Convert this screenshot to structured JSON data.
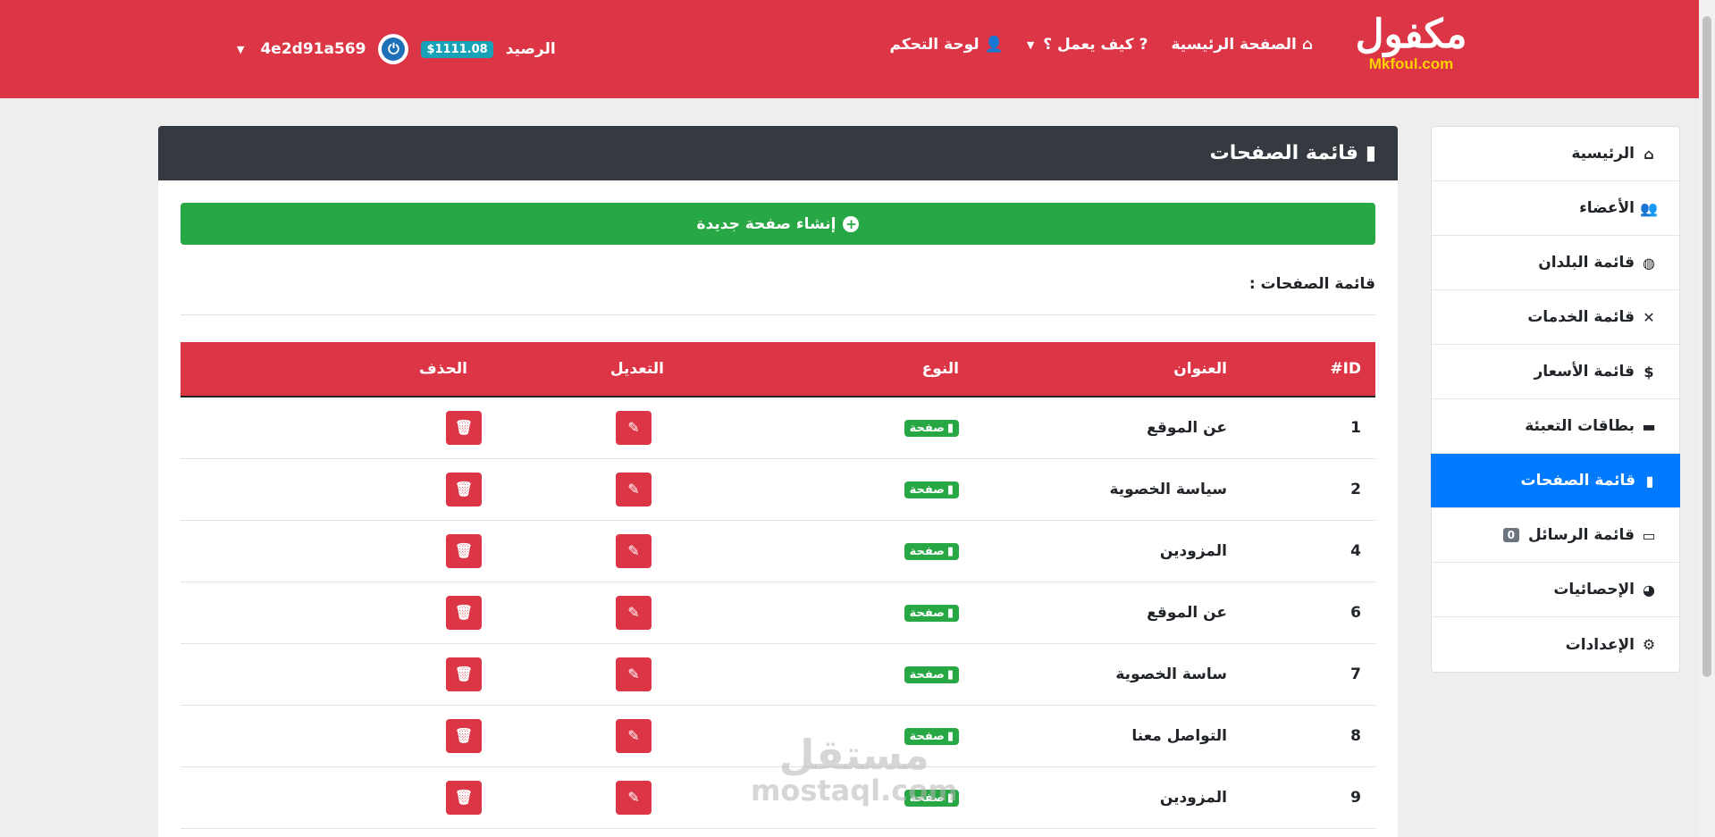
{
  "header": {
    "logo_ar": "مكفول",
    "logo_en": "Mkfoul.com",
    "nav": [
      {
        "label": "الصفحة الرئيسية",
        "icon": "home-icon"
      },
      {
        "label": "كيف يعمل ؟",
        "icon": "question-circle-icon"
      },
      {
        "label": "لوحة التحكم",
        "icon": "user-cog-icon"
      }
    ],
    "balance_label": "الرصيد",
    "balance_value": "$1111.08",
    "username": "4e2d91a569"
  },
  "sidebar": {
    "items": [
      {
        "label": "الرئيسية",
        "icon": "home-icon",
        "glyph": "⌂"
      },
      {
        "label": "الأعضاء",
        "icon": "users-icon",
        "glyph": "👥"
      },
      {
        "label": "قائمة البلدان",
        "icon": "globe-icon",
        "glyph": "◍"
      },
      {
        "label": "قائمة الخدمات",
        "icon": "tools-icon",
        "glyph": "✕"
      },
      {
        "label": "قائمة الأسعار",
        "icon": "dollar-icon",
        "glyph": "$"
      },
      {
        "label": "بطاقات التعبئة",
        "icon": "credit-card-icon",
        "glyph": "▬"
      },
      {
        "label": "قائمة الصفحات",
        "icon": "file-icon",
        "glyph": "▮"
      },
      {
        "label": "قائمة الرسائل",
        "icon": "inbox-icon",
        "glyph": "▭",
        "badge": "0"
      },
      {
        "label": "الإحصائيات",
        "icon": "pie-chart-icon",
        "glyph": "◕"
      },
      {
        "label": "الإعدادات",
        "icon": "cogs-icon",
        "glyph": "⚙"
      }
    ],
    "active": "قائمة الصفحات"
  },
  "main": {
    "title": "قائمة الصفحات",
    "create_button": "إنشاء صفحة جديدة",
    "list_label": "قائمة الصفحات :",
    "table": {
      "headers": [
        "ID#",
        "العنوان",
        "النوع",
        "التعديل",
        "الحذف"
      ],
      "rows": [
        {
          "id": "1",
          "title": "عن الموقع",
          "type": "صفحة"
        },
        {
          "id": "2",
          "title": "سياسة الخصوية",
          "type": "صفحة"
        },
        {
          "id": "4",
          "title": "المزودين",
          "type": "صفحة"
        },
        {
          "id": "6",
          "title": "عن الموقع",
          "type": "صفحة"
        },
        {
          "id": "7",
          "title": "ساسة الخصوية",
          "type": "صفحة"
        },
        {
          "id": "8",
          "title": "التواصل معنا",
          "type": "صفحة"
        },
        {
          "id": "9",
          "title": "المزودين",
          "type": "صفحة"
        }
      ]
    }
  },
  "watermark": {
    "ar": "مستقل",
    "en": "mostaql.com"
  },
  "colors": {
    "primary_red": "#dc3545",
    "dark_header": "#343a40",
    "success_green": "#28a745",
    "active_blue": "#007bff"
  }
}
